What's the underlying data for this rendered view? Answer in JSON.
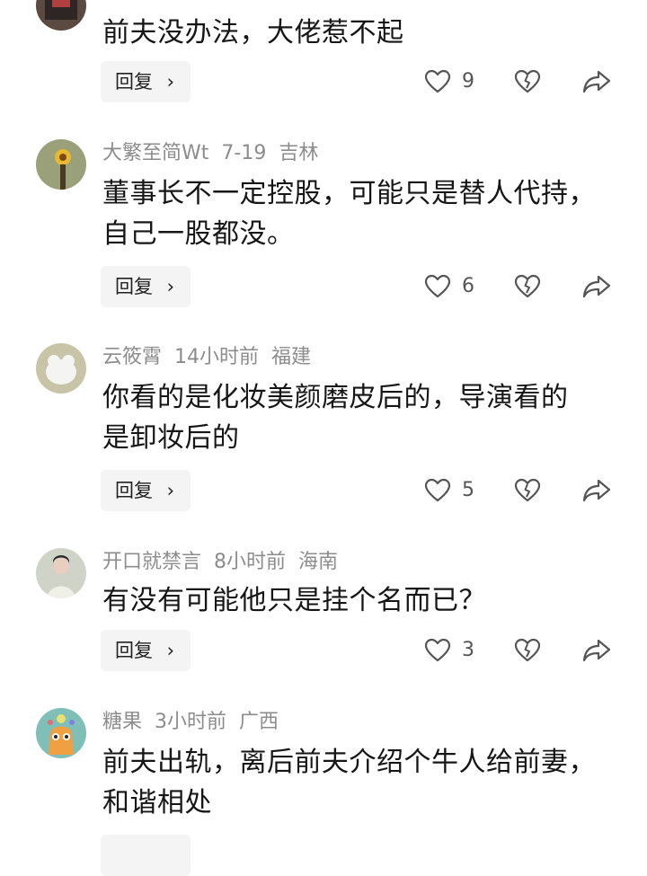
{
  "reply_label": "回复",
  "reply_chevron": "›",
  "comments": [
    {
      "text_lines": [
        "前夫没办法，大佬惹不起"
      ],
      "likes": "9"
    },
    {
      "username": "大繁至简Wt",
      "date": "7-19",
      "location": "吉林",
      "text_lines": [
        "董事长不一定控股，可能只是替人代持，",
        "自己一股都没。"
      ],
      "likes": "6"
    },
    {
      "username": "云筱霄",
      "date": "14小时前",
      "location": "福建",
      "text_lines": [
        "你看的是化妆美颜磨皮后的，导演看的",
        "是卸妆后的"
      ],
      "likes": "5"
    },
    {
      "username": "开口就禁言",
      "date": "8小时前",
      "location": "海南",
      "text_lines": [
        "有没有可能他只是挂个名而已？"
      ],
      "likes": "3"
    },
    {
      "username": "糖果",
      "date": "3小时前",
      "location": "广西",
      "text_lines": [
        "前夫出轨，离后前夫介绍个牛人给前妻，",
        "和谐相处"
      ]
    }
  ]
}
